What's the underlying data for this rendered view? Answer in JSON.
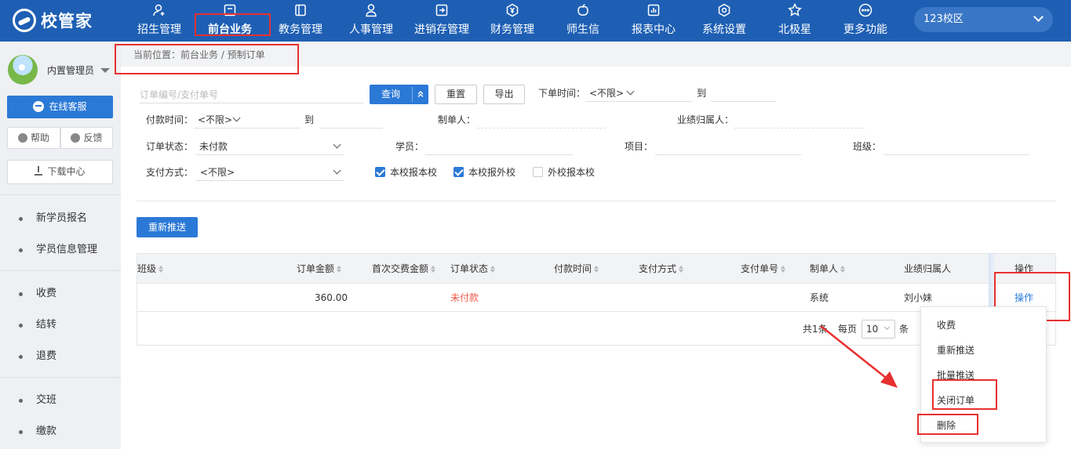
{
  "brand": {
    "logo_text": "校管家"
  },
  "nav": {
    "items": [
      {
        "label": "招生管理",
        "icon": "user-plus-icon"
      },
      {
        "label": "前台业务",
        "icon": "desk-icon",
        "active": true
      },
      {
        "label": "教务管理",
        "icon": "book-icon"
      },
      {
        "label": "人事管理",
        "icon": "person-icon"
      },
      {
        "label": "进销存管理",
        "icon": "inventory-icon"
      },
      {
        "label": "财务管理",
        "icon": "yen-icon"
      },
      {
        "label": "师生信",
        "icon": "apple-icon"
      },
      {
        "label": "报表中心",
        "icon": "report-icon"
      },
      {
        "label": "系统设置",
        "icon": "gear-icon"
      },
      {
        "label": "北极星",
        "icon": "star-icon"
      },
      {
        "label": "更多功能",
        "icon": "more-icon"
      }
    ],
    "campus": "123校区"
  },
  "sidebar": {
    "user_name": "内置管理员",
    "online_service": "在线客服",
    "help": "帮助",
    "feedback": "反馈",
    "download": "下载中心",
    "items": [
      "新学员报名",
      "学员信息管理",
      "收费",
      "结转",
      "退费",
      "交班",
      "缴款"
    ]
  },
  "breadcrumb": "当前位置：前台业务 / 预制订单",
  "filters": {
    "search_placeholder": "订单编号/支付单号",
    "query": "查询",
    "reset": "重置",
    "export": "导出",
    "order_time_label": "下单时间：",
    "order_time_value": "<不限>",
    "to": "到",
    "pay_time_label": "付款时间：",
    "pay_time_value": "<不限>",
    "creator_label": "制单人：",
    "performance_label": "业绩归属人：",
    "order_status_label": "订单状态：",
    "order_status_value": "未付款",
    "student_label": "学员：",
    "project_label": "项目：",
    "class_label": "班级：",
    "pay_method_label": "支付方式：",
    "pay_method_value": "<不限>",
    "checks": [
      {
        "label": "本校报本校",
        "checked": true
      },
      {
        "label": "本校报外校",
        "checked": true
      },
      {
        "label": "外校报本校",
        "checked": false
      }
    ]
  },
  "actions": {
    "repush": "重新推送"
  },
  "table": {
    "headers": [
      "班级",
      "订单金额",
      "首次交费金额",
      "订单状态",
      "付款时间",
      "支付方式",
      "支付单号",
      "制单人",
      "业绩归属人",
      "操作"
    ],
    "row": {
      "amount": "360.00",
      "status": "未付款",
      "creator": "系统",
      "performance": "刘小妹",
      "op": "操作"
    },
    "pager": {
      "total": "共1条",
      "per_page": "每页",
      "size": "10",
      "unit": "条"
    }
  },
  "op_menu": [
    "收费",
    "重新推送",
    "批量推送",
    "关闭订单",
    "删除"
  ],
  "colors": {
    "primary": "#2b79d6",
    "nav_bg": "#1e5fb4",
    "highlight": "#e83030",
    "status_unpaid": "#ee5a4a"
  }
}
